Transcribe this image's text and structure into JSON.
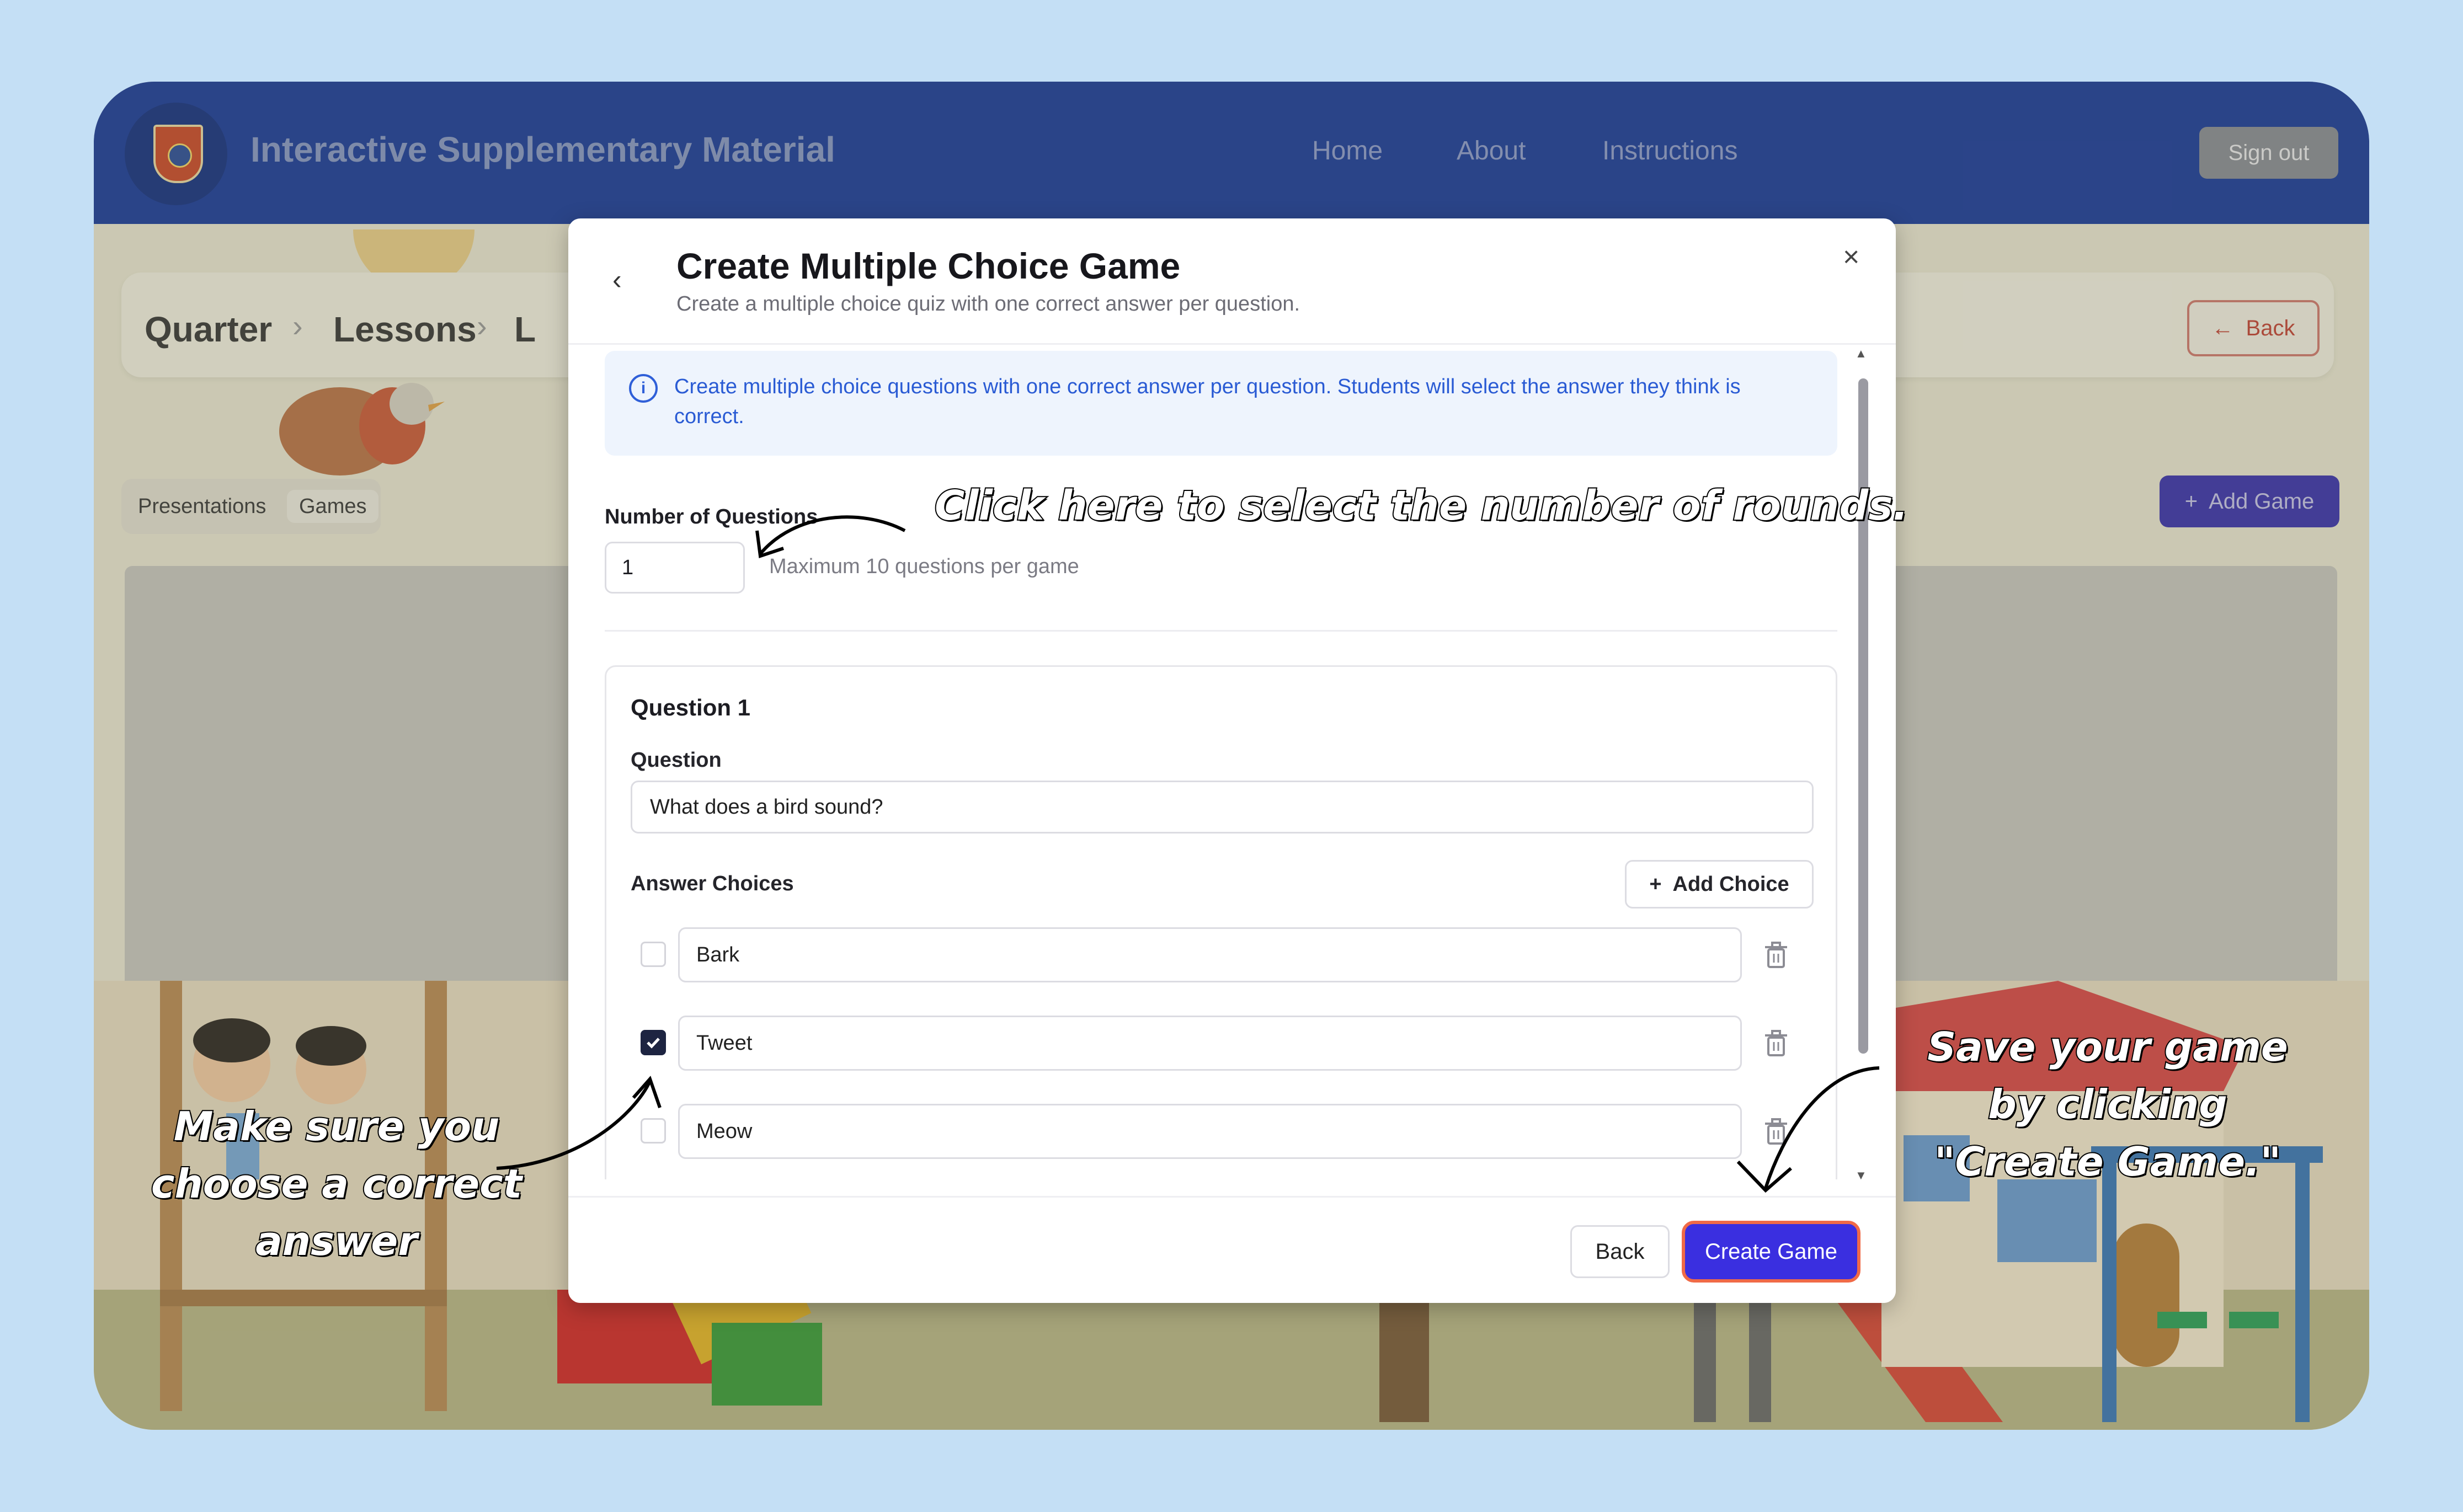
{
  "header": {
    "app_title": "Interactive Supplementary Material",
    "nav": [
      "Home",
      "About",
      "Instructions"
    ],
    "sign_out_label": "Sign out",
    "brand_color": "#1c3d9c"
  },
  "background_page": {
    "breadcrumb": [
      "Quarter",
      "Lessons",
      "L"
    ],
    "back_label": "Back",
    "tabs": [
      "Presentations",
      "Games"
    ],
    "active_tab": "Games",
    "add_game_label": "Add Game"
  },
  "modal": {
    "title": "Create Multiple Choice Game",
    "subtitle": "Create a multiple choice quiz with one correct answer per question.",
    "info_text": "Create multiple choice questions with one correct answer per question. Students will select the answer they think is correct.",
    "number_of_questions": {
      "label": "Number of Questions",
      "value": "1",
      "hint": "Maximum 10 questions per game"
    },
    "question": {
      "heading": "Question 1",
      "label": "Question",
      "value": "What does a bird sound?",
      "choices_label": "Answer Choices",
      "add_choice_label": "Add Choice",
      "choices": [
        {
          "text": "Bark",
          "correct": false
        },
        {
          "text": "Tweet",
          "correct": true
        },
        {
          "text": "Meow",
          "correct": false
        }
      ]
    },
    "footer": {
      "back_label": "Back",
      "create_label": "Create Game",
      "create_color": "#3a2fe0",
      "highlight_color": "#f06a47"
    }
  },
  "annotations": {
    "rounds": "Click here to select the number of rounds.",
    "correct_answer": "Make sure you choose a correct answer",
    "save": "Save your game by clicking \"Create Game.\""
  },
  "icons": [
    "logo-icon",
    "chevron-left-icon",
    "close-icon",
    "info-icon",
    "plus-icon",
    "checkbox-icon",
    "trash-icon",
    "arrow-left-icon"
  ]
}
